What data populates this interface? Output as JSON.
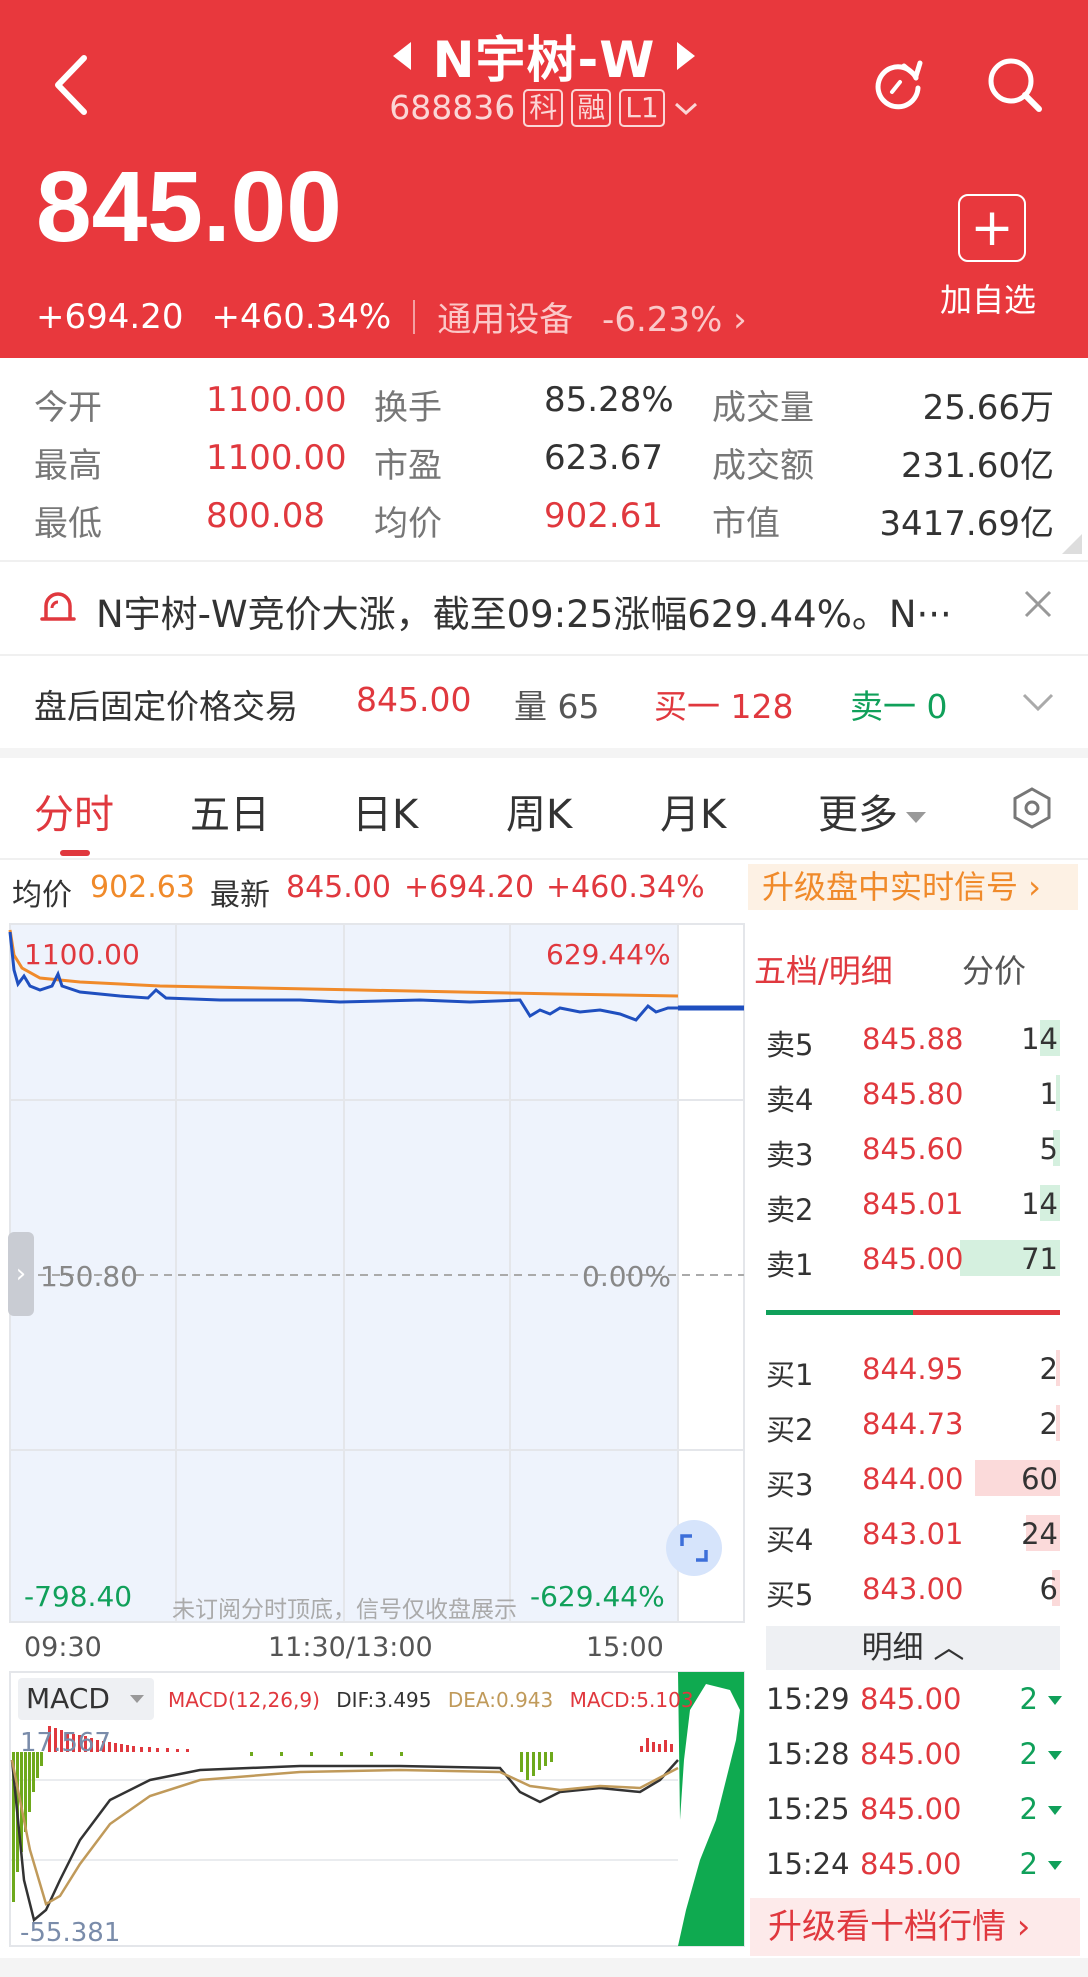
{
  "header": {
    "stock_name": "N宇树-W",
    "stock_code": "688836",
    "tags": [
      "科",
      "融",
      "L1"
    ],
    "price": "845.00",
    "change": "+694.20",
    "change_pct": "+460.34%",
    "industry_name": "通用设备",
    "industry_change": "-6.23%",
    "add_watch_label": "加自选",
    "bg_color": "#e8383d"
  },
  "stats": [
    {
      "label": "今开",
      "value": "1100.00"
    },
    {
      "label": "换手",
      "value": "85.28%"
    },
    {
      "label": "成交量",
      "value": "25.66万"
    },
    {
      "label": "最高",
      "value": "1100.00"
    },
    {
      "label": "市盈",
      "value": "623.67"
    },
    {
      "label": "成交额",
      "value": "231.60亿"
    },
    {
      "label": "最低",
      "value": "800.08"
    },
    {
      "label": "均价",
      "value": "902.61"
    },
    {
      "label": "市值",
      "value": "3417.69亿"
    }
  ],
  "news": {
    "text": "N宇树-W竞价大涨，截至09:25涨幅629.44%。N···"
  },
  "after_hours": {
    "label": "盘后固定价格交易",
    "price": "845.00",
    "volume": "量 65",
    "buy1": "买一 128",
    "sell1": "卖一 0"
  },
  "tabs": [
    "分时",
    "五日",
    "日K",
    "周K",
    "月K",
    "更多"
  ],
  "info_row": {
    "avg_label": "均价",
    "avg_value": "902.63",
    "latest_label": "最新",
    "latest_value": "845.00",
    "change": "+694.20",
    "change_pct": "+460.34%",
    "upgrade_signal": "升级盘中实时信号 ›"
  },
  "chart": {
    "top_price": "1100.00",
    "top_pct": "629.44%",
    "mid_price": "150.80",
    "mid_pct": "0.00%",
    "bottom_price": "-798.40",
    "bottom_pct": "-629.44%",
    "watermark": "未订阅分时顶底，信号仅收盘展示",
    "time_labels": [
      "09:30",
      "11:30/13:00",
      "15:00"
    ]
  },
  "macd": {
    "label": "MACD",
    "params": "MACD(12,26,9)",
    "dif": "DIF:3.495",
    "dea": "DEA:0.943",
    "macd": "MACD:5.103",
    "top_value": "17.567",
    "bottom_value": "-55.381"
  },
  "orderbook": {
    "header_left": "五档/明细",
    "header_right": "分价",
    "sells": [
      {
        "label": "卖5",
        "price": "845.88",
        "vol": "14",
        "fill": 0.2
      },
      {
        "label": "卖4",
        "price": "845.80",
        "vol": "1",
        "fill": 0.02
      },
      {
        "label": "卖3",
        "price": "845.60",
        "vol": "5",
        "fill": 0.07
      },
      {
        "label": "卖2",
        "price": "845.01",
        "vol": "14",
        "fill": 0.2
      },
      {
        "label": "卖1",
        "price": "845.00",
        "vol": "71",
        "fill": 1.0
      }
    ],
    "buys": [
      {
        "label": "买1",
        "price": "844.95",
        "vol": "2",
        "fill": 0.03
      },
      {
        "label": "买2",
        "price": "844.73",
        "vol": "2",
        "fill": 0.03
      },
      {
        "label": "买3",
        "price": "844.00",
        "vol": "60",
        "fill": 0.85
      },
      {
        "label": "买4",
        "price": "843.01",
        "vol": "24",
        "fill": 0.34
      },
      {
        "label": "买5",
        "price": "843.00",
        "vol": "6",
        "fill": 0.08
      }
    ],
    "detail_label": "明细 ︿",
    "ticks": [
      {
        "time": "15:29",
        "price": "845.00",
        "vol": "2"
      },
      {
        "time": "15:28",
        "price": "845.00",
        "vol": "2"
      },
      {
        "time": "15:25",
        "price": "845.00",
        "vol": "2"
      },
      {
        "time": "15:24",
        "price": "845.00",
        "vol": "2"
      }
    ],
    "upgrade_ten": "升级看十档行情 ›"
  }
}
